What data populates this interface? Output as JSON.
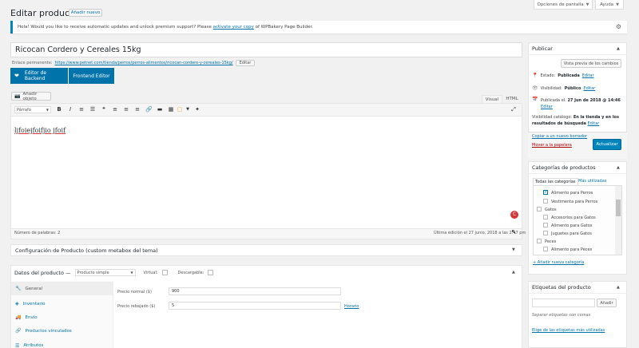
{
  "header": {
    "title": "Editar producto",
    "add_new": "Añadir nuevo",
    "screen_options": "Opciones de pantalla",
    "help": "Ayuda"
  },
  "notice": {
    "text_before": "Hola! Would you like to receive automatic updates and unlock premium support? Please ",
    "link": "activate your copy",
    "text_after": " of WPBakery Page Builder."
  },
  "post": {
    "title": "Ricocan Cordero y Cereales 15kg",
    "permalink_label": "Enlace permanente:",
    "permalink_url": "https://www.petnet.com/tienda/perros/perros-alimentos/ricocan-cordero-y-cereales-15kg/",
    "permalink_edit": "Editar"
  },
  "builder": {
    "backend": "Editor de Backend",
    "frontend": "Frontend Editor"
  },
  "editor": {
    "add_object": "Añadir objeto",
    "tab_visual": "Visual",
    "tab_html": "HTML",
    "format_select": "Párrafo",
    "content": "ljfoiejfoifjio jfoif",
    "word_count": "Número de palabras: 2",
    "last_edit": "Última edición el 27 junio, 2018 a las 2:47 pm"
  },
  "custom_metabox": {
    "title": "Configuración de Producto (custom metabox del tema)"
  },
  "product_data": {
    "title": "Datos del producto —",
    "type": "Producto simple",
    "virtual_label": "Virtual:",
    "downloadable_label": "Descargable:",
    "tabs": [
      "General",
      "Inventario",
      "Envío",
      "Productos vinculados",
      "Atributos"
    ],
    "regular_price_label": "Precio normal ($)",
    "regular_price": "900",
    "sale_price_label": "Precio rebajado ($)",
    "sale_price": "5",
    "schedule": "Horario"
  },
  "publish": {
    "title": "Publicar",
    "preview": "Vista previa de los cambios",
    "status_label": "Estado:",
    "status_value": "Publicada",
    "status_edit": "Editar",
    "visibility_label": "Visibilidad:",
    "visibility_value": "Público",
    "visibility_edit": "Editar",
    "published_label": "Publicada el:",
    "published_value": "27 Jun de 2018 @ 14:46",
    "published_edit": "Editar",
    "catalog_label": "Visibilidad catálogo:",
    "catalog_value": "En la tienda y en los resultados de búsqueda",
    "catalog_edit": "Editar",
    "copy_draft": "Copiar a un nuevo borrador",
    "trash": "Mover a la papelera",
    "update": "Actualizar"
  },
  "categories": {
    "title": "Categorías de productos",
    "tab_all": "Todas las categorías",
    "tab_used": "Más utilizadas",
    "items": [
      {
        "label": "Alimento para Perros",
        "checked": true
      },
      {
        "label": "Vestimenta para Perros",
        "checked": false
      },
      {
        "label": "Gatos",
        "checked": false
      },
      {
        "label": "Accesorios para Gatos",
        "checked": false
      },
      {
        "label": "Alimento para Gatos",
        "checked": false
      },
      {
        "label": "Juguetes para Gatos",
        "checked": false
      },
      {
        "label": "Peces",
        "checked": false
      },
      {
        "label": "Alimento para Peces",
        "checked": false
      }
    ],
    "add_new": "+ Añadir nueva categoría"
  },
  "tags": {
    "title": "Etiquetas del producto",
    "add_button": "Añadir",
    "hint": "Separar etiquetas con comas",
    "choose_link": "Elige de las etiquetas más utilizadas"
  },
  "colors": {
    "link": "#0073aa",
    "primary": "#0085ba",
    "trash": "#a00",
    "error_badge": "#d63638"
  }
}
